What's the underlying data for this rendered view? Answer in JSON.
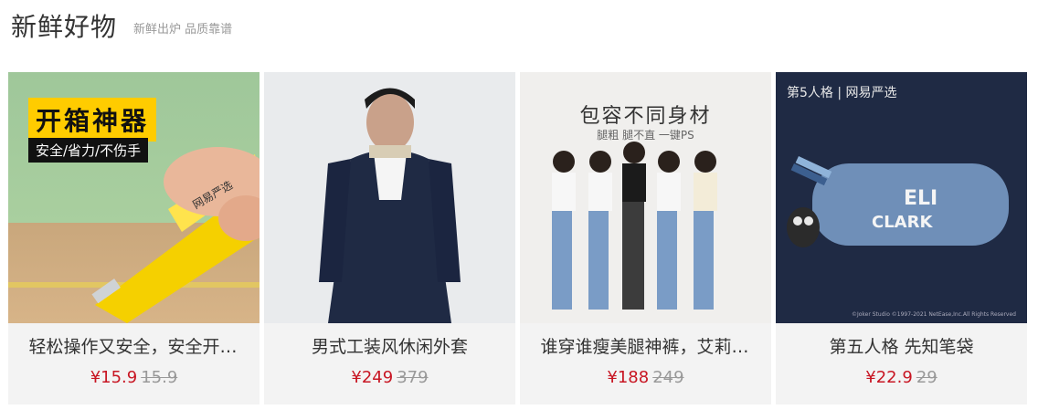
{
  "header": {
    "title": "新鲜好物",
    "subtitle": "新鲜出炉 品质靠谱"
  },
  "products": [
    {
      "name": "轻松操作又安全，安全开箱刀",
      "price": "¥15.9",
      "old_price": "15.9",
      "image": {
        "banner_title": "开箱神器",
        "banner_sub": "安全/省力/不伤手",
        "logo": "网易严选"
      }
    },
    {
      "name": "男式工装风休闲外套",
      "price": "¥249",
      "old_price": "379",
      "image": {}
    },
    {
      "name": "谁穿谁瘦美腿神裤，艾莉森修身牛仔裤",
      "price": "¥188",
      "old_price": "249",
      "image": {
        "headline": "包容不同身材",
        "sub": "腿粗 腿不直 一键PS"
      }
    },
    {
      "name": "第五人格 先知笔袋",
      "price": "¥22.9",
      "old_price": "29",
      "image": {
        "brand": "第5人格 | 网易严选",
        "case_text_1": "ELI",
        "case_text_2": "CLARK",
        "copyright": "©Joker Studio ©1997-2021 NetEase,Inc.All Rights Reserved"
      }
    }
  ],
  "colors": {
    "price": "#c81623",
    "old_price": "#999999",
    "card_bg": "#f3f3f3"
  }
}
